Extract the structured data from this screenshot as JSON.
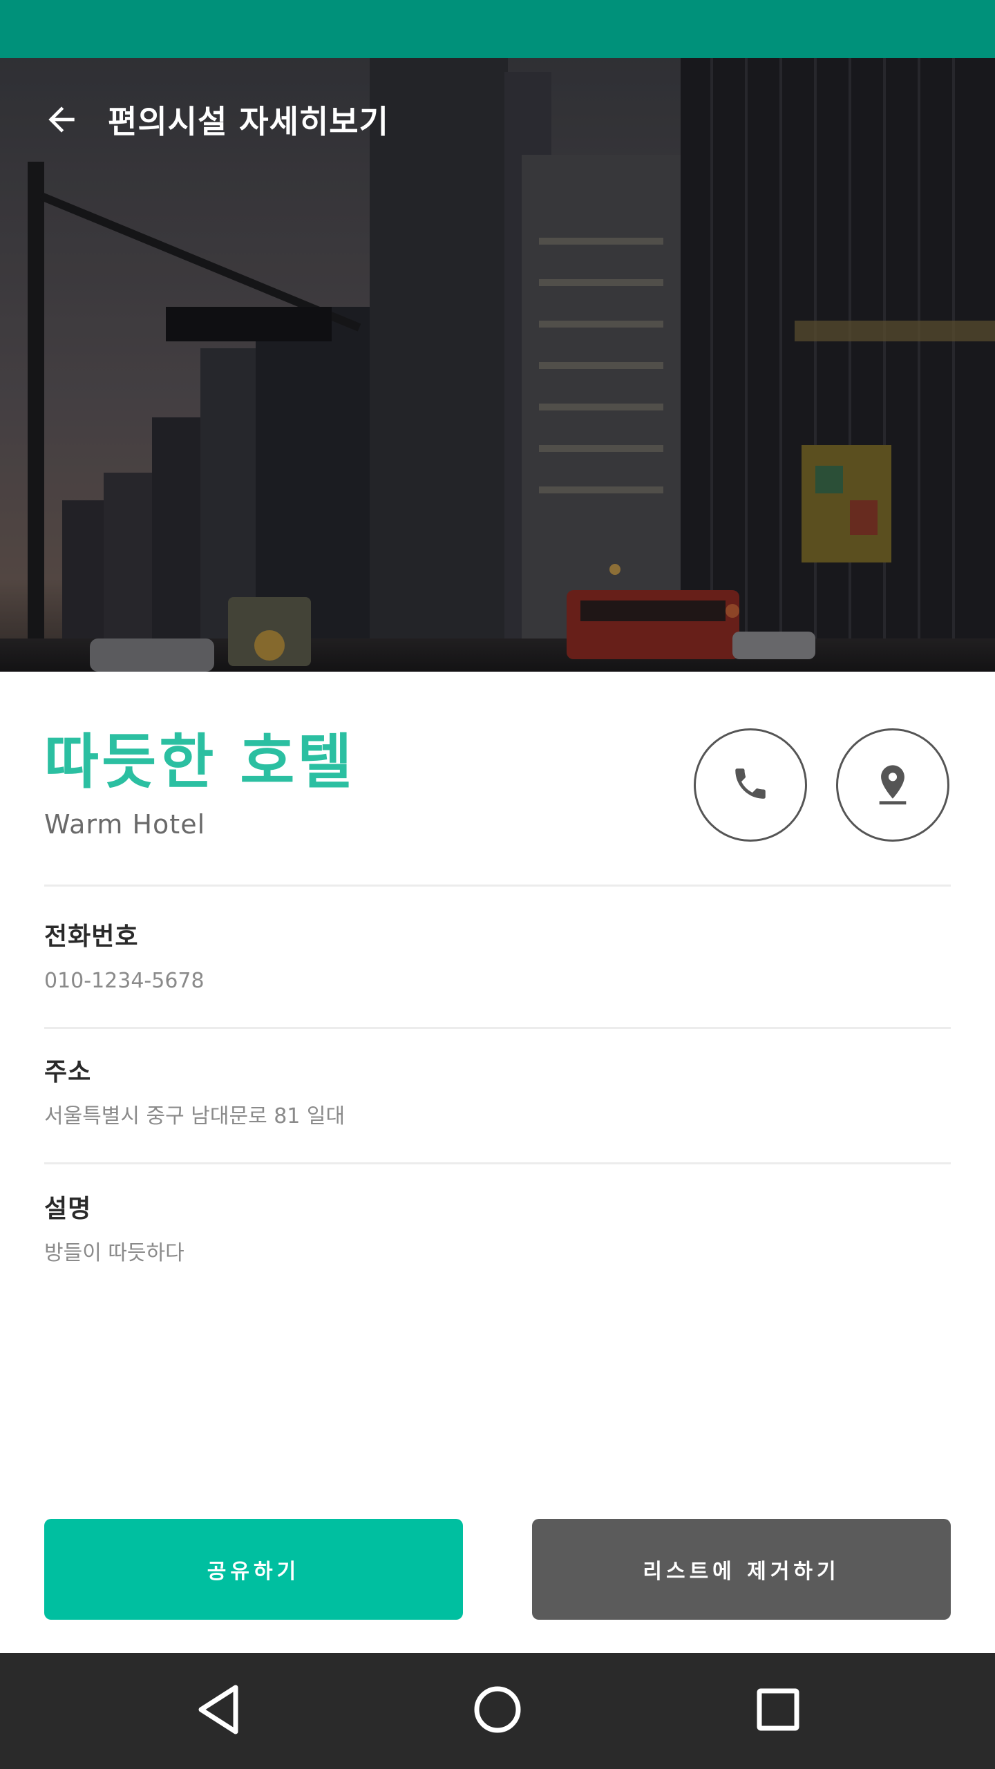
{
  "app_bar": {
    "title": "편의시설 자세히보기",
    "back_icon": "arrow-back-icon"
  },
  "hero": {
    "description_icon": "city-street-photo"
  },
  "facility": {
    "name": "따듯한 호텔",
    "name_en": "Warm Hotel"
  },
  "actions_top": {
    "call_icon": "phone-icon",
    "map_icon": "location-pin-icon"
  },
  "fields": {
    "phone": {
      "label": "전화번호",
      "value": "010-1234-5678"
    },
    "address": {
      "label": "주소",
      "value": "서울특별시 중구 남대문로 81 일대"
    },
    "description": {
      "label": "설명",
      "value": "방들이 따듯하다"
    }
  },
  "buttons": {
    "share_label": "공유하기",
    "remove_label": "리스트에 제거하기"
  },
  "colors": {
    "status_bar": "#00917a",
    "accent": "#2bbfa1",
    "share_button": "#00bfa0",
    "remove_button": "#5b5b5b",
    "nav_bar": "#2a2a2a"
  },
  "system_nav": {
    "back_icon": "triangle-back-icon",
    "home_icon": "circle-home-icon",
    "recent_icon": "square-recents-icon"
  }
}
